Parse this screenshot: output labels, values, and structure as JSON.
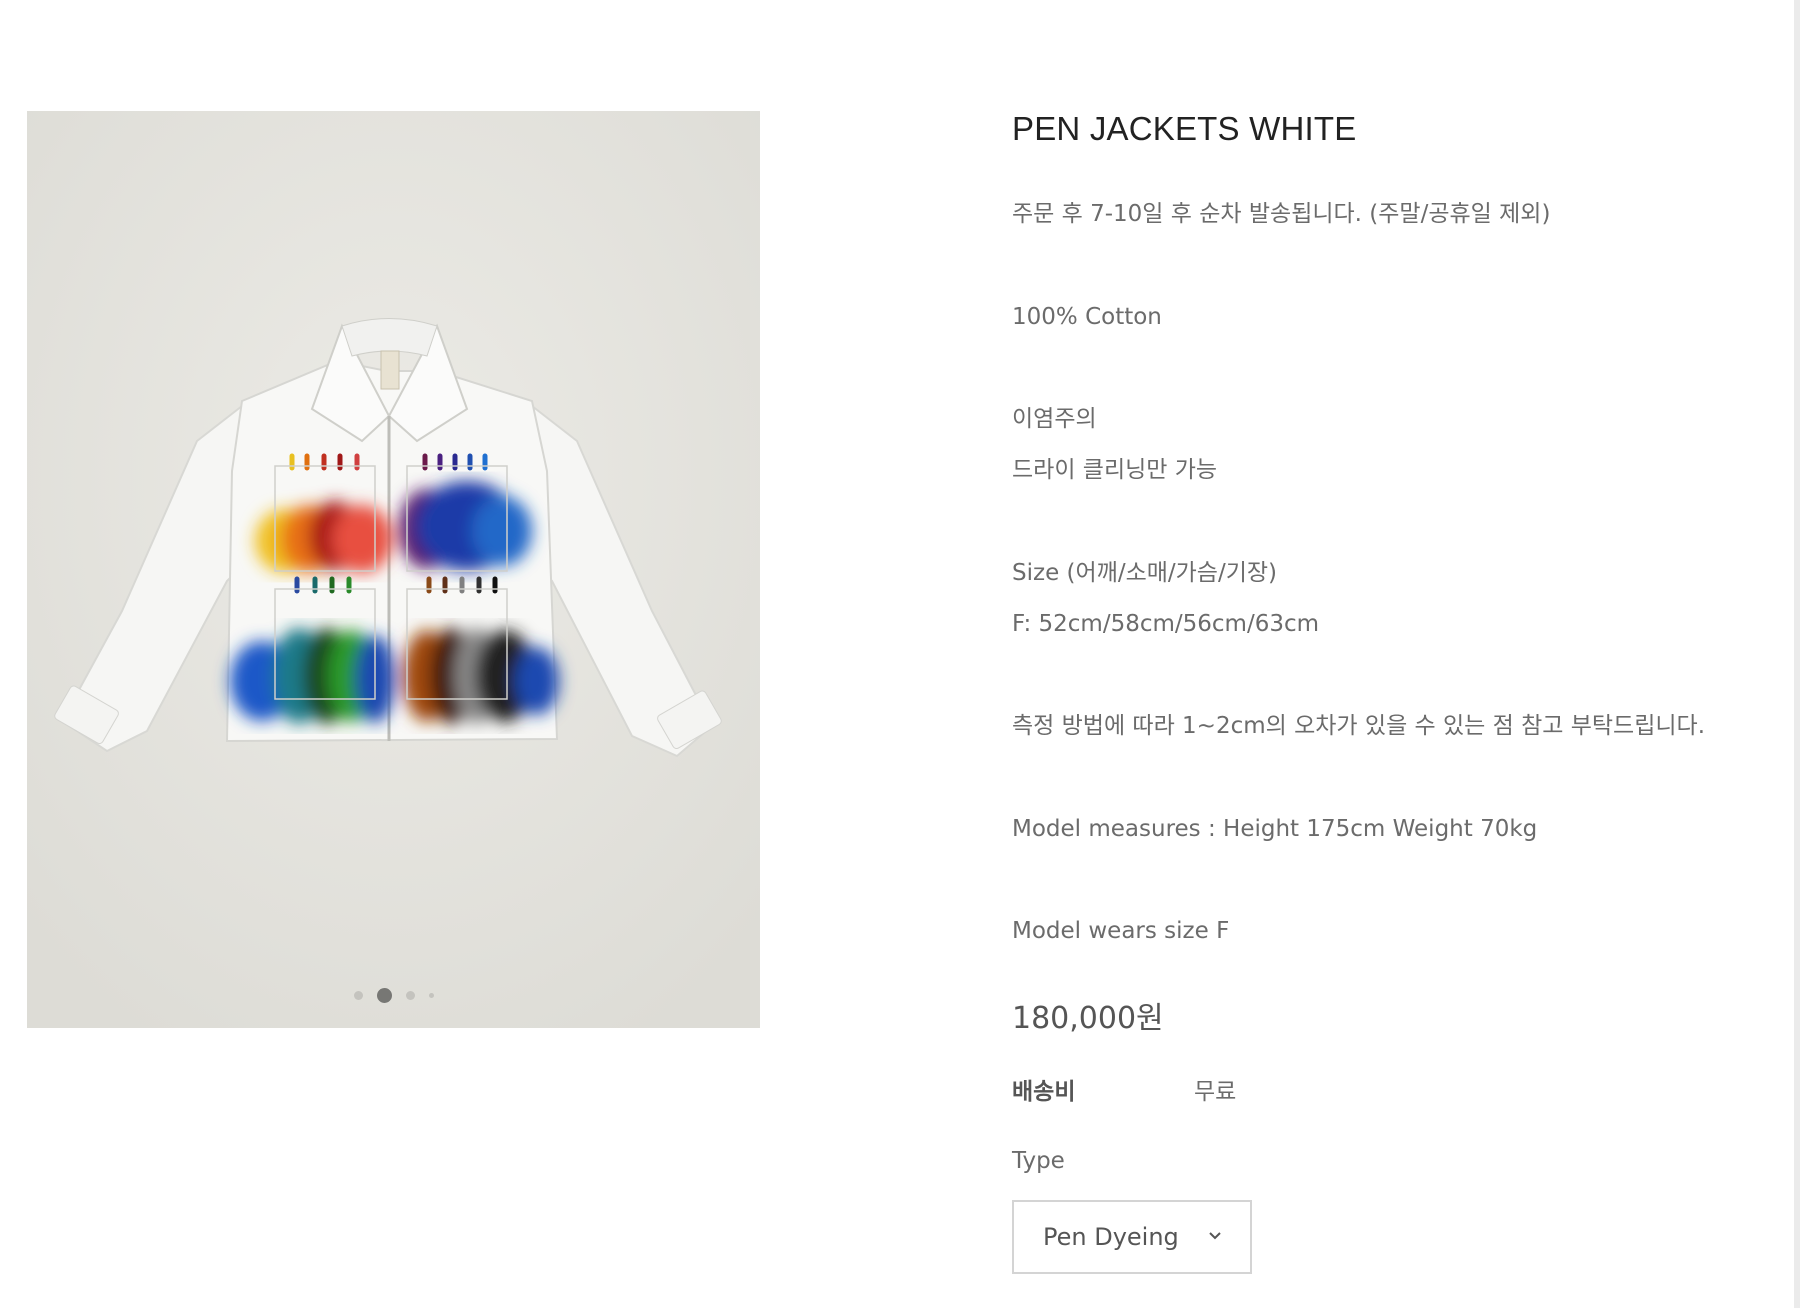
{
  "product": {
    "title": "PEN JACKETS WHITE",
    "shipping_notice": "주문 후 7-10일 후 순차 발송됩니다. (주말/공휴일 제외)",
    "material": "100% Cotton",
    "care_1": "이염주의",
    "care_2": "드라이 클리닝만 가능",
    "size_header": "Size (어깨/소매/가슴/기장)",
    "size_values": "F: 52cm/58cm/56cm/63cm",
    "measure_note": "측정 방법에 따라 1~2cm의 오차가 있을 수 있는 점 참고 부탁드립니다.",
    "model_measures": "Model measures : Height 175cm Weight 70kg",
    "model_size": "Model wears size F",
    "price": "180,000원"
  },
  "shipping": {
    "label": "배송비",
    "value": "무료"
  },
  "options": {
    "type_label": "Type",
    "type_selected": "Pen Dyeing"
  },
  "gallery": {
    "total": 4,
    "active_index": 1
  },
  "icons": {
    "dropdown": "chevron-down-icon"
  }
}
